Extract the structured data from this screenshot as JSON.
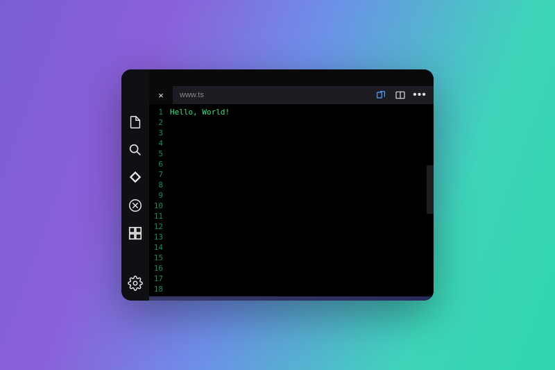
{
  "tabs": {
    "active": {
      "close": "×"
    },
    "inactive": {
      "label": "www.ts"
    }
  },
  "editor": {
    "line_count": 18,
    "code": {
      "line1": "Hello, World!"
    }
  },
  "icons": {
    "ellipsis": "•••"
  },
  "colors": {
    "code_text": "#3be081",
    "gutter_text": "#1a8a68",
    "editor_bg": "#000000",
    "activity_bg": "#101014"
  }
}
